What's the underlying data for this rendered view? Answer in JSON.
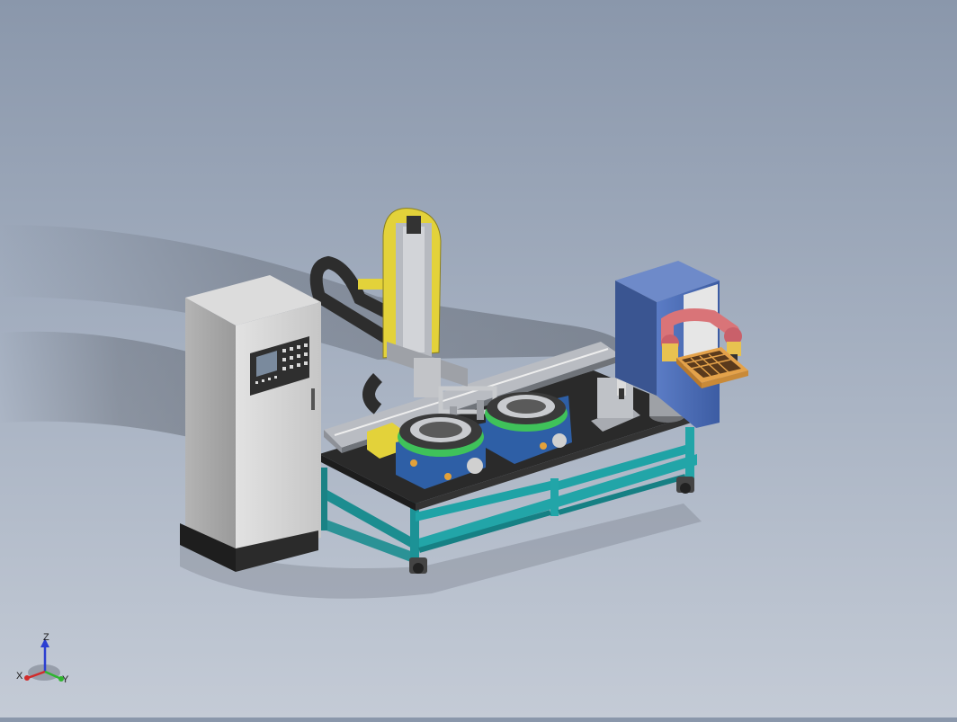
{
  "viewport": {
    "background_top": "#8a97ab",
    "background_bottom": "#c4cbd6"
  },
  "scene": {
    "components": [
      "control-cabinet",
      "cnc-operator-panel",
      "gantry-z-axis",
      "cable-carrier",
      "linear-x-axis",
      "gripper",
      "rotary-fixture-left",
      "rotary-fixture-right",
      "inspection-station",
      "cylinder-station",
      "robot-arm",
      "part-tray",
      "electrical-enclosure",
      "steel-frame-base",
      "caster-wheels"
    ],
    "colors": {
      "cabinet": "#d4d4d4",
      "frame": "#1fa3a6",
      "fixture_blue": "#2e5fa6",
      "fixture_ring": "#3fc25a",
      "gantry_yellow": "#e3d23a",
      "robot_pink": "#d97478",
      "tray_orange": "#e4a24a",
      "enclosure_blue": "#4a6cb5",
      "table_top": "#2a2a2a"
    }
  },
  "triad": {
    "x_label": "X",
    "y_label": "Y",
    "z_label": "Z",
    "x_color": "#d12b2b",
    "y_color": "#2fb52f",
    "z_color": "#2b3fd1"
  }
}
